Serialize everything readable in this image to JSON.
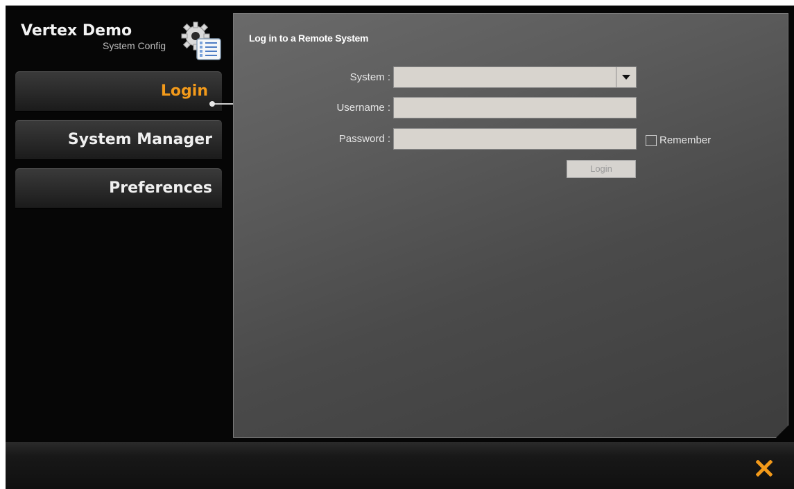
{
  "brand": {
    "title": "Vertex Demo",
    "subtitle": "System Config",
    "icon": "gear-checklist-icon"
  },
  "nav": {
    "items": [
      {
        "label": "Login",
        "active": true
      },
      {
        "label": "System Manager",
        "active": false
      },
      {
        "label": "Preferences",
        "active": false
      }
    ]
  },
  "form": {
    "title": "Log in to a Remote System",
    "system_label": "System :",
    "system_value": "",
    "username_label": "Username :",
    "username_value": "",
    "password_label": "Password :",
    "password_value": "",
    "remember_label": "Remember",
    "remember_checked": false,
    "login_button": "Login"
  },
  "footer": {
    "close_icon": "close-icon"
  },
  "colors": {
    "accent": "#f39a1a",
    "panel": "#5b5b5b",
    "field_bg": "#d8d4ce"
  }
}
